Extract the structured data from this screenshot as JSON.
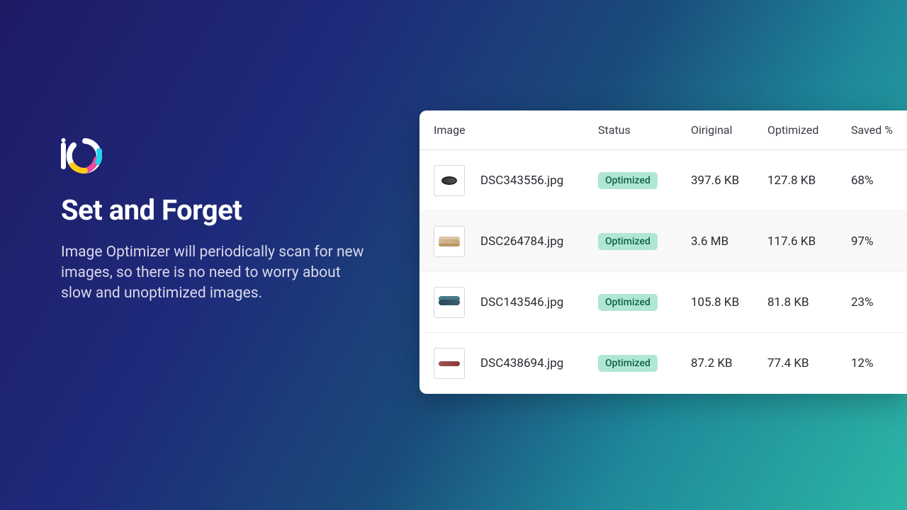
{
  "left": {
    "logo_alt": "Image Optimizer logo",
    "heading": "Set and Forget",
    "description": "Image Optimizer will periodically scan for new images, so there is no need to worry about slow and unoptimized images."
  },
  "table": {
    "headers": {
      "image": "Image",
      "status": "Status",
      "original": "Oiriginal",
      "optimized": "Optimized",
      "saved": "Saved %"
    },
    "rows": [
      {
        "filename": "DSC343556.jpg",
        "status": "Optimized",
        "original": "397.6 KB",
        "optimized": "127.8 KB",
        "saved": "68%"
      },
      {
        "filename": "DSC264784.jpg",
        "status": "Optimized",
        "original": "3.6 MB",
        "optimized": "117.6 KB",
        "saved": "97%"
      },
      {
        "filename": "DSC143546.jpg",
        "status": "Optimized",
        "original": "105.8 KB",
        "optimized": "81.8 KB",
        "saved": "23%"
      },
      {
        "filename": "DSC438694.jpg",
        "status": "Optimized",
        "original": "87.2 KB",
        "optimized": "77.4 KB",
        "saved": "12%"
      }
    ]
  }
}
